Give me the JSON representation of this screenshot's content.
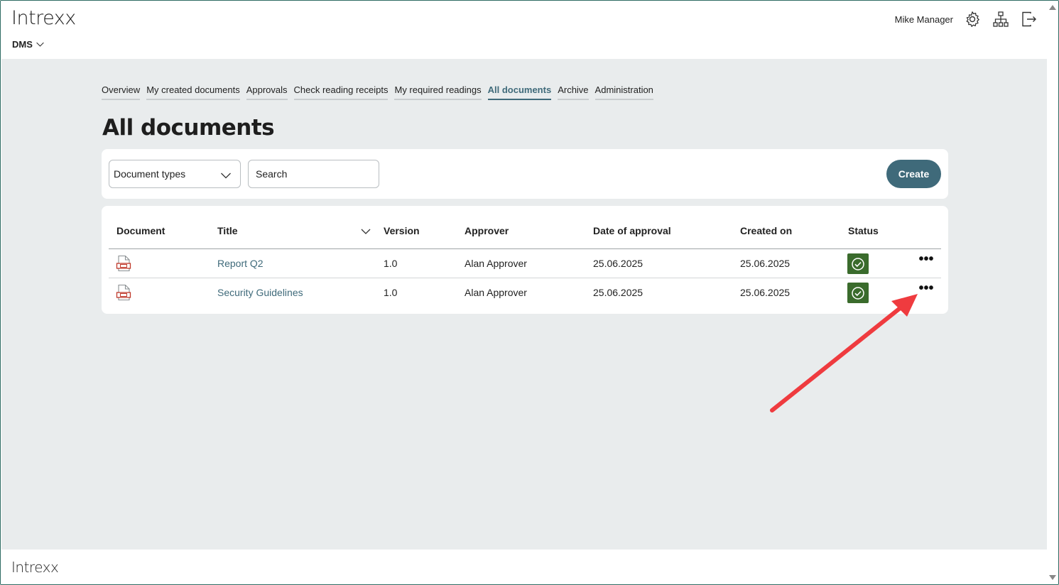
{
  "header": {
    "logo": "Intrexx",
    "app_menu": "DMS",
    "user_name": "Mike Manager"
  },
  "nav": {
    "tabs": [
      {
        "label": "Overview",
        "active": false
      },
      {
        "label": "My created documents",
        "active": false
      },
      {
        "label": "Approvals",
        "active": false
      },
      {
        "label": "Check reading receipts",
        "active": false
      },
      {
        "label": "My required readings",
        "active": false
      },
      {
        "label": "All documents",
        "active": true
      },
      {
        "label": "Archive",
        "active": false
      },
      {
        "label": "Administration",
        "active": false
      }
    ]
  },
  "page": {
    "title": "All documents"
  },
  "toolbar": {
    "document_types": "Document types",
    "search_placeholder": "Search",
    "create_label": "Create"
  },
  "table": {
    "columns": [
      "Document",
      "Title",
      "Version",
      "Approver",
      "Date of approval",
      "Created on",
      "Status"
    ],
    "rows": [
      {
        "title": "Report Q2",
        "version": "1.0",
        "approver": "Alan Approver",
        "date_of_approval": "25.06.2025",
        "created_on": "25.06.2025",
        "status": "approved",
        "more": "•••"
      },
      {
        "title": "Security Guidelines",
        "version": "1.0",
        "approver": "Alan Approver",
        "date_of_approval": "25.06.2025",
        "created_on": "25.06.2025",
        "status": "approved",
        "more": "•••"
      }
    ]
  },
  "footer": {
    "logo": "Intrexx"
  },
  "colors": {
    "accent": "#3f6a7a",
    "status_green": "#3a6b2c",
    "annotation_arrow": "#ef3b3f",
    "background": "#e9eced"
  },
  "icons": {
    "settings": "gear-icon",
    "sitemap": "sitemap-icon",
    "logout": "logout-icon",
    "document": "pdf-document-icon",
    "status": "check-circle-icon"
  }
}
